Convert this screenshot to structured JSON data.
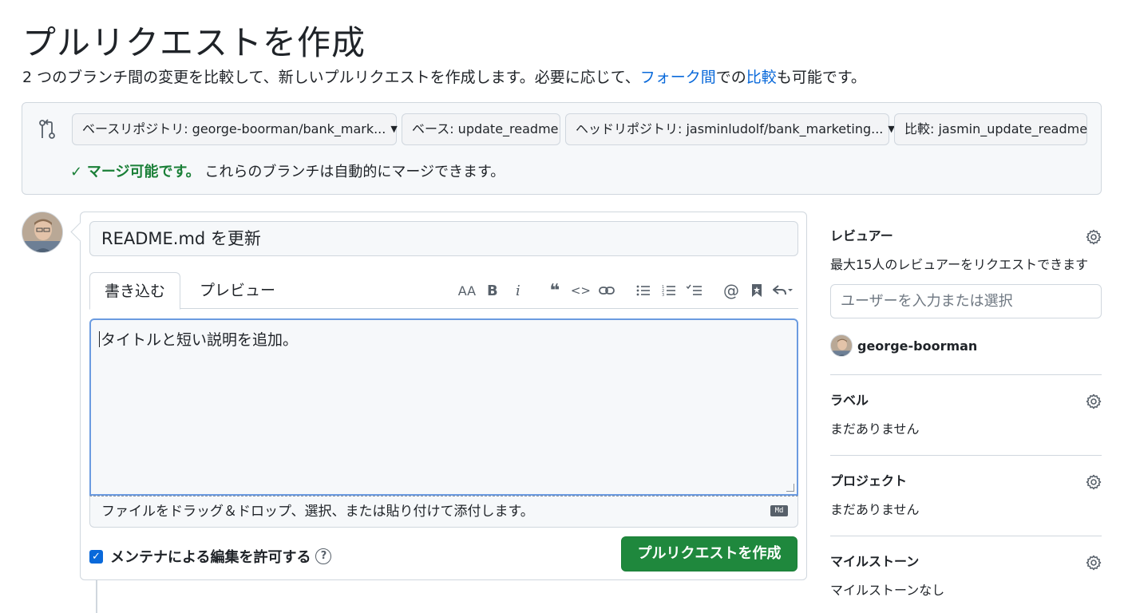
{
  "page": {
    "title": "プルリクエストを作成",
    "subtitle_pre": "2 つのブランチ間の変更を比較して、新しいプルリクエストを作成します。必要に応じて、",
    "subtitle_link1": "フォーク間",
    "subtitle_mid": "での",
    "subtitle_link2": "比較",
    "subtitle_post": "も可能です。"
  },
  "compare": {
    "base_repo": "ベースリポジトリ: george-boorman/bank_mark...",
    "base_branch": "ベース: update_readme",
    "head_repo": "ヘッドリポジトリ: jasminludolf/bank_marketing...",
    "compare_branch": "比較: jasmin_update_readme",
    "merge_check": "✓",
    "merge_ok": "マージ可能です。",
    "merge_detail": "これらのブランチは自動的にマージできます。"
  },
  "editor": {
    "title_value": "README.md を更新",
    "tabs": [
      "書き込む",
      "プレビュー"
    ],
    "body_placeholder": "タイトルと短い説明を追加。",
    "attach_hint": "ファイルをドラッグ＆ドロップ、選択、または貼り付けて添付します。",
    "md_badge": "Md",
    "toolbar": {
      "heading": "AA",
      "bold": "B",
      "italic": "i",
      "quote": "❝",
      "code": "<>"
    },
    "allow_edits_label": "メンテナによる編集を許可する",
    "help": "?",
    "create_button": "プルリクエストを作成"
  },
  "sidebar": {
    "reviewers": {
      "heading": "レビュアー",
      "note": "最大15人のレビュアーをリクエストできます",
      "input_placeholder": "ユーザーを入力または選択",
      "user": "george-boorman"
    },
    "labels": {
      "heading": "ラベル",
      "value": "まだありません"
    },
    "projects": {
      "heading": "プロジェクト",
      "value": "まだありません"
    },
    "milestone": {
      "heading": "マイルストーン",
      "value": "マイルストーンなし"
    }
  },
  "colors": {
    "accent_blue": "#0969da",
    "success_green": "#1a7f37",
    "button_green": "#1f883d",
    "border": "#d0d7de",
    "focus_border": "#6b9be0"
  }
}
